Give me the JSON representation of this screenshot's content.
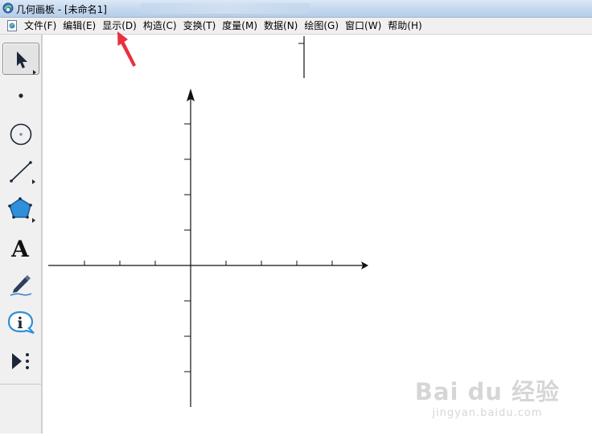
{
  "window": {
    "title": "几何画板 - [未命名1]"
  },
  "menu": {
    "items": [
      {
        "label": "文件(F)"
      },
      {
        "label": "编辑(E)"
      },
      {
        "label": "显示(D)"
      },
      {
        "label": "构造(C)"
      },
      {
        "label": "变换(T)"
      },
      {
        "label": "度量(M)"
      },
      {
        "label": "数据(N)"
      },
      {
        "label": "绘图(G)"
      },
      {
        "label": "窗口(W)"
      },
      {
        "label": "帮助(H)"
      }
    ]
  },
  "toolbox": {
    "tools": [
      {
        "name": "arrow-tool",
        "icon": "arrow-icon",
        "selected": true
      },
      {
        "name": "point-tool",
        "icon": "point-icon"
      },
      {
        "name": "compass-tool",
        "icon": "circle-icon"
      },
      {
        "name": "straightedge-tool",
        "icon": "segment-icon"
      },
      {
        "name": "polygon-tool",
        "icon": "pentagon-icon"
      },
      {
        "name": "text-tool",
        "icon": "text-icon",
        "label": "A"
      },
      {
        "name": "marker-tool",
        "icon": "marker-icon"
      },
      {
        "name": "information-tool",
        "icon": "info-icon",
        "label": "i"
      },
      {
        "name": "custom-tool",
        "icon": "custom-tool-icon"
      }
    ]
  },
  "annotation": {
    "arrow_color": "#e8313c"
  },
  "watermark": {
    "brand": "Bai du 经验",
    "url": "jingyan.baidu.com"
  }
}
